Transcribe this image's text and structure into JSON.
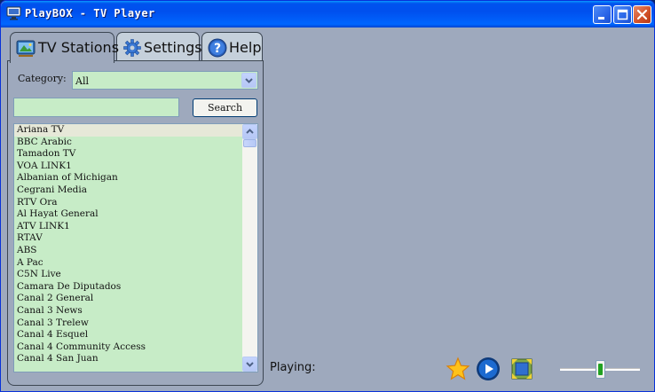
{
  "window": {
    "title": "PlayBOX - TV Player"
  },
  "tabs": [
    {
      "label": "TV Stations",
      "icon": "tv-icon",
      "active": true
    },
    {
      "label": "Settings",
      "icon": "gear-icon",
      "active": false
    },
    {
      "label": "Help",
      "icon": "help-icon",
      "active": false
    }
  ],
  "category": {
    "label": "Category:",
    "selected": "All"
  },
  "search": {
    "value": "",
    "button_label": "Search"
  },
  "stations": [
    "Ariana TV",
    "BBC Arabic",
    "Tamadon TV",
    "VOA LINK1",
    "Albanian of Michigan",
    "Cegrani Media",
    "RTV Ora",
    "Al Hayat General",
    "ATV LINK1",
    "RTAV",
    "ABS",
    "A Pac",
    "C5N Live",
    "Camara De Diputados",
    "Canal 2 General",
    "Canal 3 News",
    "Canal 3 Trelew",
    "Canal 4 Esquel",
    "Canal 4 Community Access",
    "Canal 4 San Juan"
  ],
  "selected_station": "Ariana TV",
  "player": {
    "status_label": "Playing:",
    "controls": [
      "star-icon",
      "play-icon",
      "fullscreen-icon"
    ],
    "volume": 0.5
  },
  "colors": {
    "titlebar": "#0053ee",
    "background": "#9ea9bd",
    "list_background": "#c7ecc7"
  }
}
